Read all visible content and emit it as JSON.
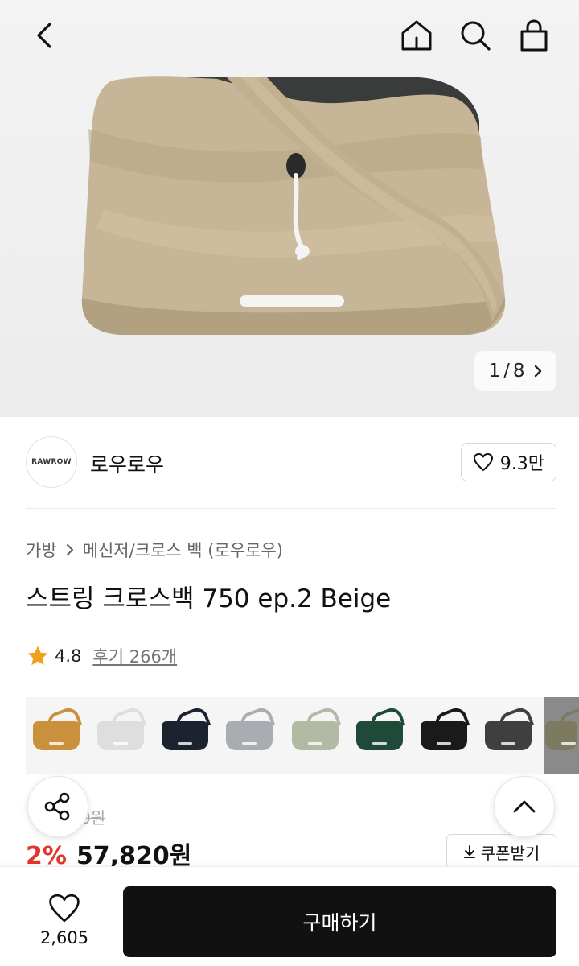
{
  "header": {
    "back_icon": "chevron-left-icon",
    "home_icon": "home-icon",
    "search_icon": "search-icon",
    "cart_icon": "shopping-bag-icon"
  },
  "gallery": {
    "current": "1",
    "separator": "/",
    "total": "8"
  },
  "brand": {
    "logo_text": "RAWROW",
    "name": "로우로우",
    "likes": "9.3만"
  },
  "breadcrumb": {
    "items": [
      "가방",
      "메신저/크로스 백 (로우로우)"
    ]
  },
  "product": {
    "title": "스트링 크로스백 750 ep.2 Beige",
    "rating": "4.8",
    "reviews": "후기 266개"
  },
  "swatches": {
    "colors": [
      "#c9913c",
      "#dedede",
      "#1c2230",
      "#a9adb2",
      "#b3baa4",
      "#1f4a3a",
      "#1a1a1a",
      "#3f3f3f",
      "#7d7a62"
    ]
  },
  "price": {
    "original_fragment": "0원",
    "discount": "2%",
    "sale": "57,820원",
    "coupon_label": "쿠폰받기"
  },
  "bottom": {
    "wish_count": "2,605",
    "buy_label": "구매하기"
  },
  "colors": {
    "accent_red": "#e0362c",
    "buy_bg": "#111111"
  }
}
